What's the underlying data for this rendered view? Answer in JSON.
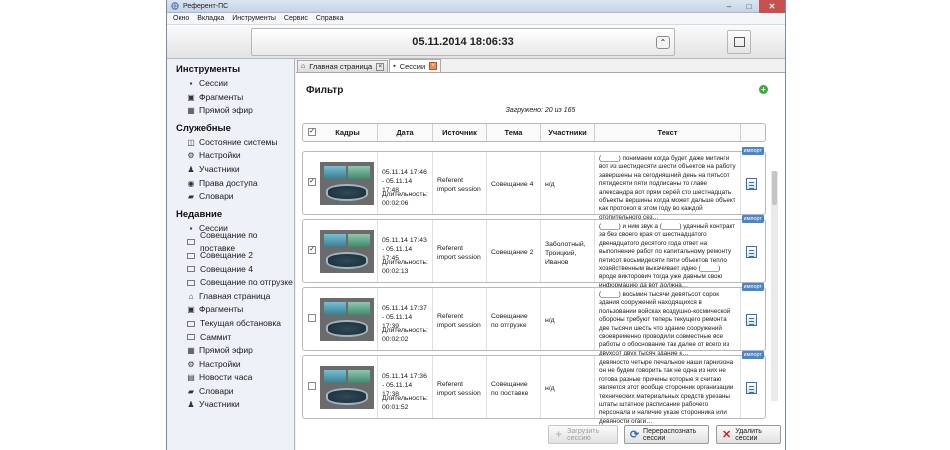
{
  "window": {
    "title": "Референт-ПС",
    "controls": [
      "–",
      "□",
      "✕"
    ]
  },
  "menu": [
    "Окно",
    "Вкладка",
    "Инструменты",
    "Сервис",
    "Справка"
  ],
  "clock": {
    "datetime": "05.11.2014 18:06:33",
    "collapse_glyph": "⌃"
  },
  "sidebar": {
    "sections": [
      {
        "title": "Инструменты",
        "items": [
          {
            "icon": "sessions-icon",
            "glyph": "▪",
            "label": "Сессии"
          },
          {
            "icon": "fragments-icon",
            "glyph": "▣",
            "label": "Фрагменты"
          },
          {
            "icon": "live-icon",
            "glyph": "▦",
            "label": "Прямой эфир"
          }
        ]
      },
      {
        "title": "Служебные",
        "items": [
          {
            "icon": "system-state-icon",
            "glyph": "◫",
            "label": "Состояние системы"
          },
          {
            "icon": "settings-icon",
            "glyph": "⚙",
            "label": "Настройки"
          },
          {
            "icon": "participant-icon",
            "glyph": "♟",
            "label": "Участники"
          },
          {
            "icon": "access-rights-icon",
            "glyph": "◉",
            "label": "Права доступа"
          },
          {
            "icon": "dictionaries-icon",
            "glyph": "▰",
            "label": "Словари"
          }
        ]
      },
      {
        "title": "Недавние",
        "items": [
          {
            "icon": "sessions-icon",
            "glyph": "▪",
            "label": "Сессии"
          },
          {
            "icon": "window-icon",
            "glyph": "",
            "label": "Совещание по поставке"
          },
          {
            "icon": "window-icon",
            "glyph": "",
            "label": "Совещание 2"
          },
          {
            "icon": "window-icon",
            "glyph": "",
            "label": "Совещание 4"
          },
          {
            "icon": "window-icon",
            "glyph": "",
            "label": "Совещание по отгрузке"
          },
          {
            "icon": "home-icon",
            "glyph": "⌂",
            "label": "Главная страница"
          },
          {
            "icon": "fragments-icon",
            "glyph": "▣",
            "label": "Фрагменты"
          },
          {
            "icon": "window-icon",
            "glyph": "",
            "label": "Текущая обстановка"
          },
          {
            "icon": "window-icon",
            "glyph": "",
            "label": "Саммит"
          },
          {
            "icon": "live-icon",
            "glyph": "▦",
            "label": "Прямой эфир"
          },
          {
            "icon": "settings-icon",
            "glyph": "⚙",
            "label": "Настройки"
          },
          {
            "icon": "news-icon",
            "glyph": "▤",
            "label": "Новости часа"
          },
          {
            "icon": "dictionaries-icon",
            "glyph": "▰",
            "label": "Словари"
          },
          {
            "icon": "participant-icon",
            "glyph": "♟",
            "label": "Участники"
          }
        ]
      }
    ]
  },
  "tabs": [
    {
      "label": "Главная страница",
      "icon": "home-icon",
      "glyph": "⌂",
      "close": "×",
      "active": false
    },
    {
      "label": "Сессии",
      "icon": "sessions-icon",
      "glyph": "▪",
      "close": "×",
      "active": true
    }
  ],
  "filter": {
    "title": "Фильтр",
    "add_glyph": "+",
    "loaded_text": "Загружено: 20 из 165"
  },
  "grid": {
    "select_all_checked": true,
    "columns": [
      "Кадры",
      "Дата",
      "Источник",
      "Тема",
      "Участники",
      "Текст"
    ],
    "rows": [
      {
        "checked": true,
        "check_glyph": "✓",
        "date": "05.11.14 17:46 - 05.11.14 17:48",
        "duration": "Длительность: 00:02:06",
        "source": "Referent import session",
        "topic": "Совещание 4",
        "participants": "н/д",
        "text": "(_____) понимаем когда будет даже митинги вот из шестидесяти шести объектов на работу завершены на сегодняшний день на пятьсот пятидесяти пяти подписаны то главе александра вот прям серёй сто шестнадцать объекты вершины когда может дальше объект как протокол в этом году во каждой отопительного сез…",
        "badge": "импорт"
      },
      {
        "checked": true,
        "check_glyph": "✓",
        "date": "05.11.14 17:43 - 05.11.14 17:45",
        "duration": "Длительность: 00:02:13",
        "source": "Referent import session",
        "topic": "Совещание 2",
        "participants": "Заболотный, Троицкий, Иванов",
        "text": "(_____) и ним звук а (_____) удачный контракт за без своего края от шестнадцатого двенадцатого десятого года ответ на выполнение работ по капитальному ремонту пятисот восьмидесяти пяти объектов тепло хозяйственным выкачивает идею (_____) вроде викторович тогда уже давным свою информацию да вот должна…",
        "badge": "импорт"
      },
      {
        "checked": false,
        "check_glyph": "",
        "date": "05.11.14 17:37 - 05.11.14 17:39",
        "duration": "Длительность: 00:02:02",
        "source": "Referent import session",
        "topic": "Совещание по отгрузке",
        "participants": "н/д",
        "text": "(_____) восьмин тысячи девятьсот сорок здания сооружений находящихся в пользовании войсках воздушно-космической обороны требуют теперь текущего ремонта две тысячи шесть что здание сооружений своевременно проводили совместные все работы о обоснование так далее от всего из двухсот двух тысяч здание к…",
        "badge": "импорт"
      },
      {
        "checked": false,
        "check_glyph": "",
        "date": "05.11.14 17:36 - 05.11.14 17:38",
        "duration": "Длительность: 00:01:52",
        "source": "Referent import session",
        "topic": "Совещание по поставке",
        "participants": "н/д",
        "text": "девяносто четыре печальное наши гарнизона он не будем говорить так не одна из них не готова разные причины которые я считаю является этот вообще сторонник организации технических материальных средств урезаны штаты штатное расписание рабочего персонала и наличие указе сторонника или девяности огаги…",
        "badge": "импорт"
      }
    ]
  },
  "buttons": {
    "load": "Загрузить сессию",
    "recognize": "Перераспознать сессии",
    "delete": "Удалить сессии"
  }
}
